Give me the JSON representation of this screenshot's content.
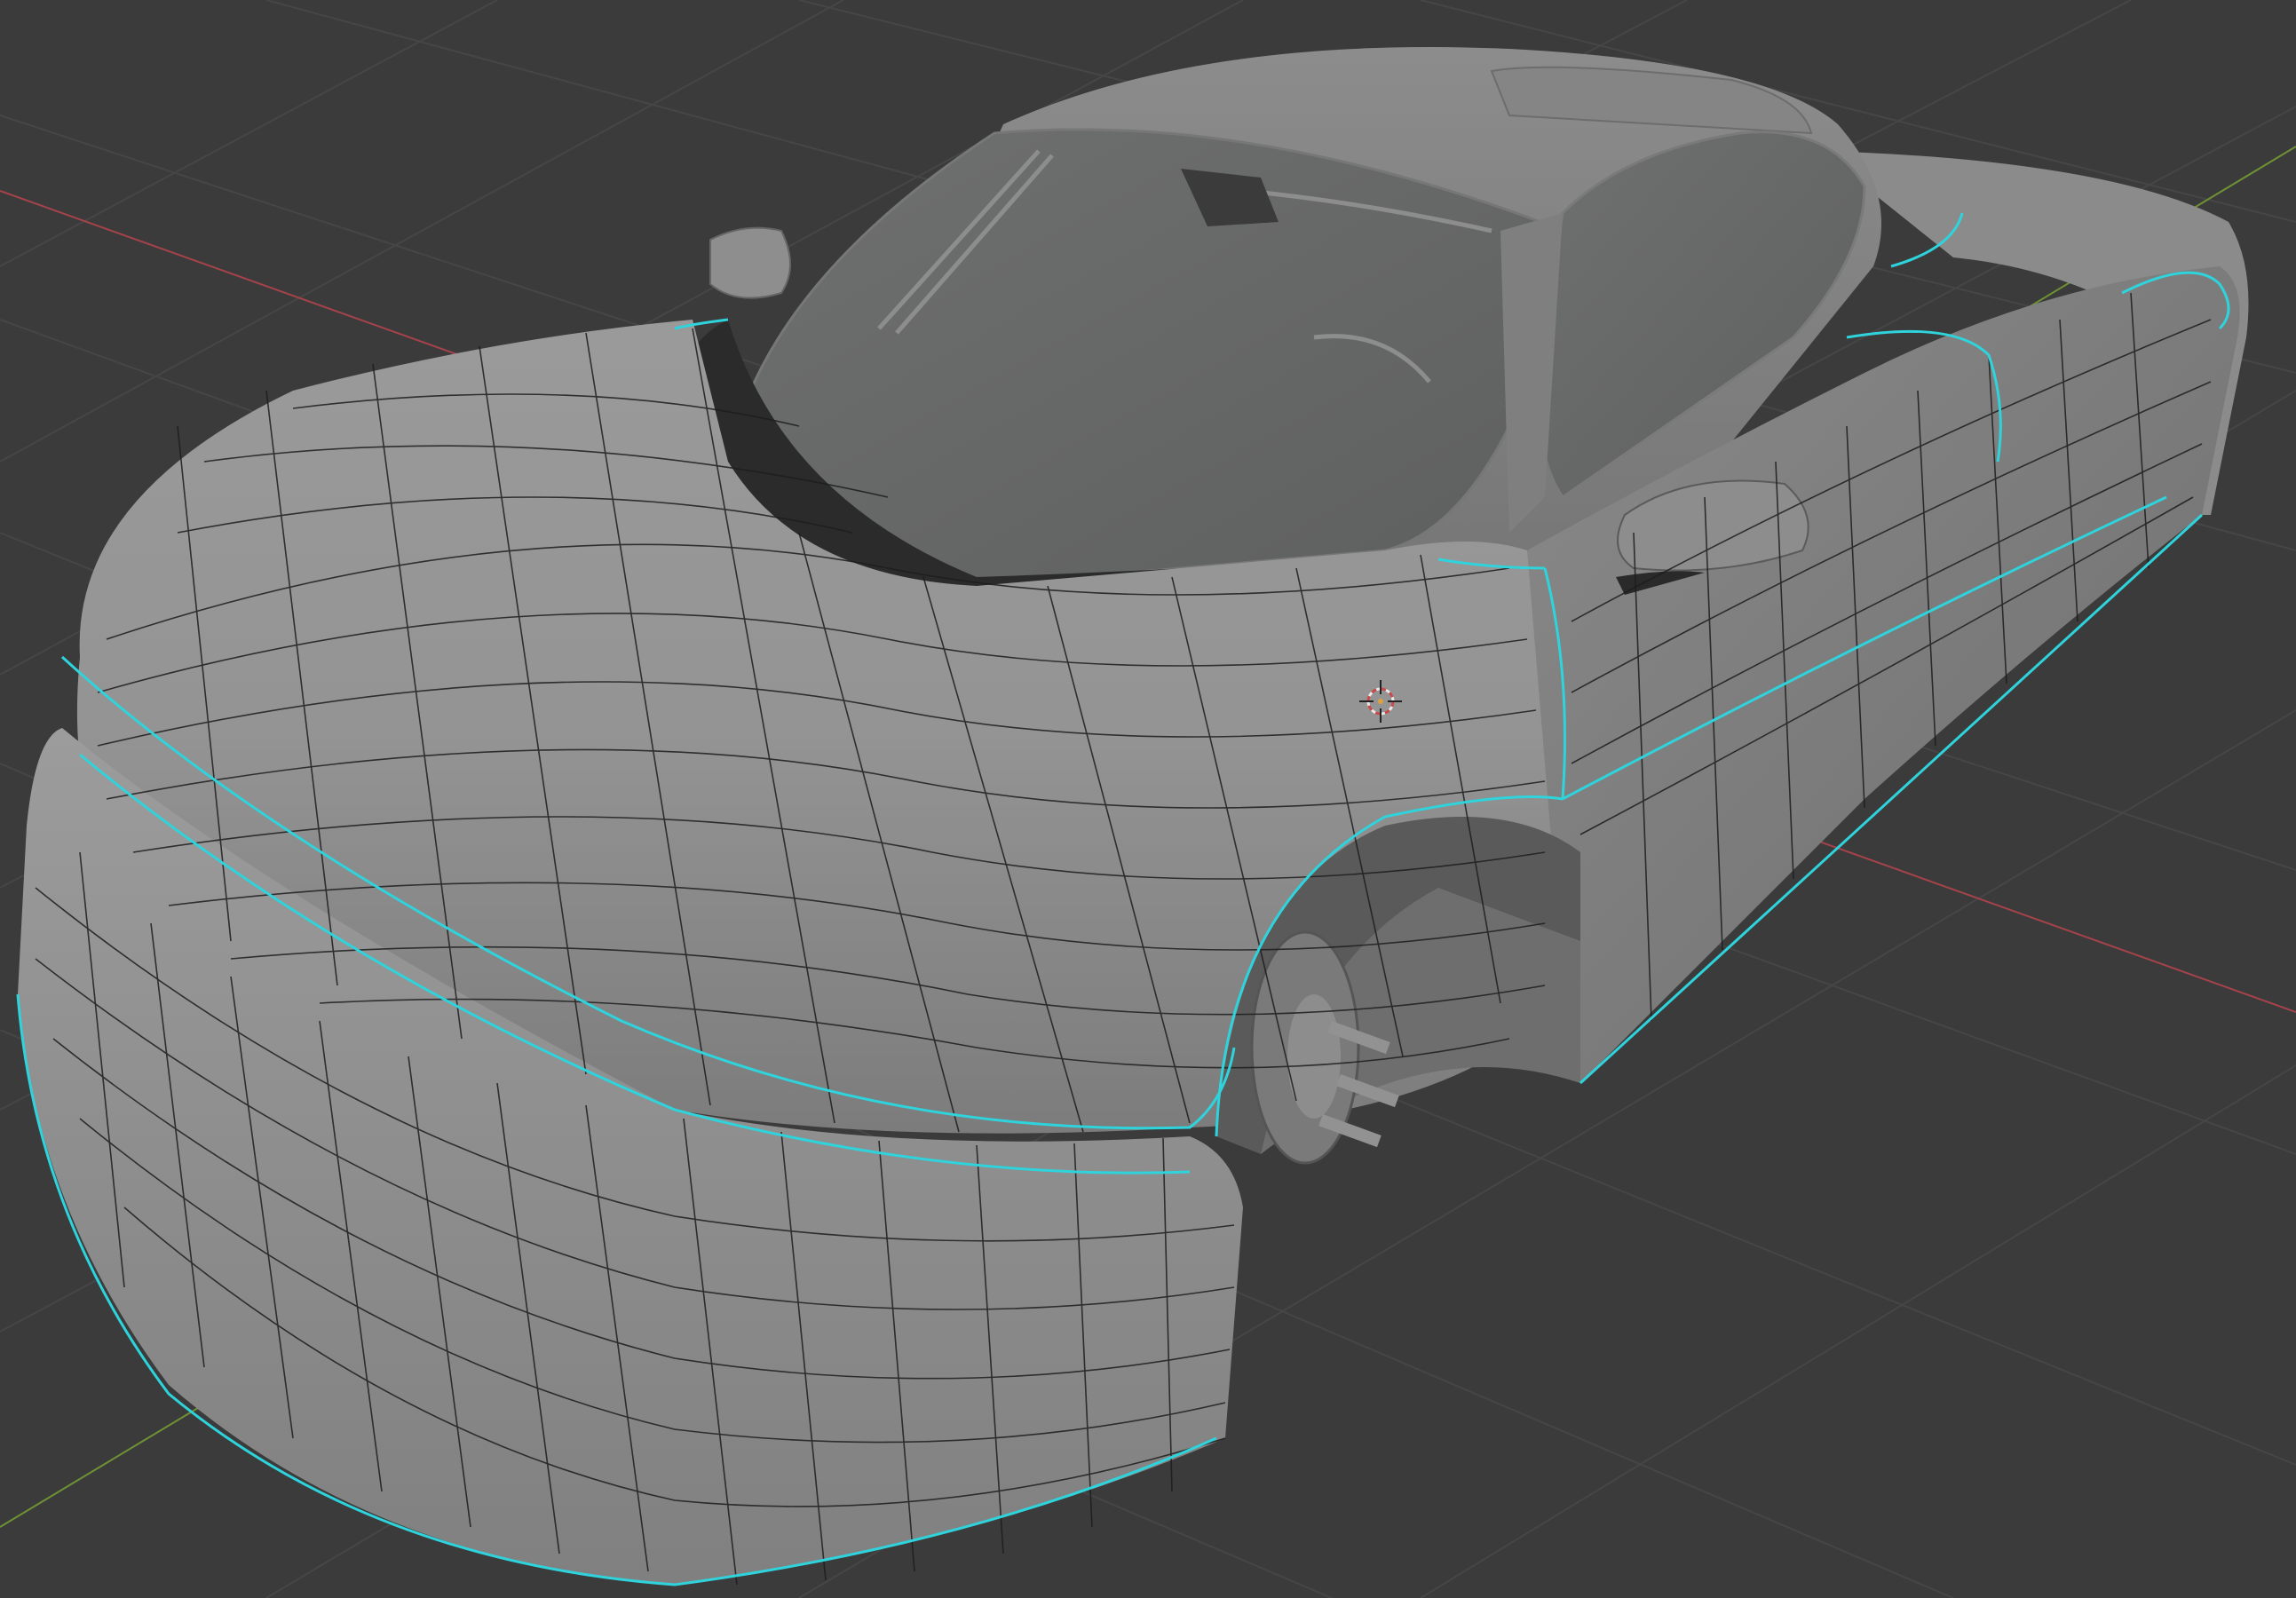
{
  "app": "3D viewport",
  "viewport": {
    "background_color": "#3b3b3b",
    "grid_color": "#454545",
    "x_axis_color": "#b34a52",
    "y_axis_color": "#7ea13a",
    "seam_color": "#2fd3dc",
    "body_color": "#8f8f8f",
    "glass_color": "#6b6c6c",
    "object": "car-body-mesh"
  }
}
